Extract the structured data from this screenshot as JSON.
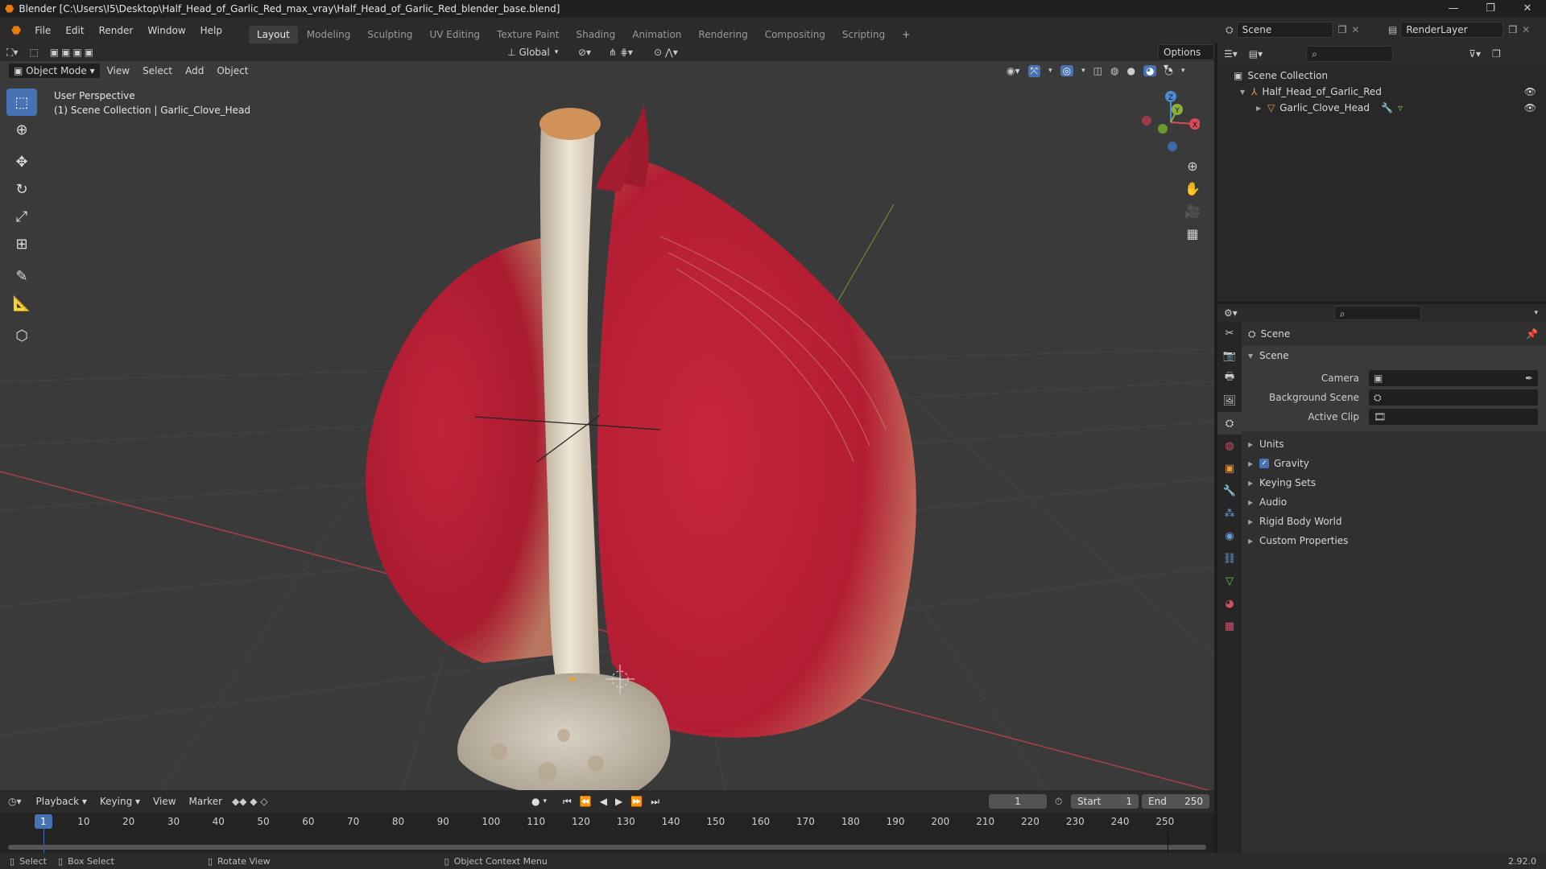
{
  "window": {
    "title": "Blender [C:\\Users\\I5\\Desktop\\Half_Head_of_Garlic_Red_max_vray\\Half_Head_of_Garlic_Red_blender_base.blend]"
  },
  "menu": [
    "File",
    "Edit",
    "Render",
    "Window",
    "Help"
  ],
  "workspaces": [
    "Layout",
    "Modeling",
    "Sculpting",
    "UV Editing",
    "Texture Paint",
    "Shading",
    "Animation",
    "Rendering",
    "Compositing",
    "Scripting"
  ],
  "top_right": {
    "scene": "Scene",
    "render_layer": "RenderLayer"
  },
  "viewport": {
    "transform_orientation": "Global",
    "options_label": "Options",
    "mode": "Object Mode",
    "header_menu": [
      "View",
      "Select",
      "Add",
      "Object"
    ],
    "overlay_line1": "User Perspective",
    "overlay_line2": "(1) Scene Collection | Garlic_Clove_Head",
    "gizmo": {
      "x": "X",
      "y": "Y",
      "z": "Z"
    }
  },
  "outliner": {
    "root": "Scene Collection",
    "items": [
      "Half_Head_of_Garlic_Red",
      "Garlic_Clove_Head"
    ]
  },
  "properties": {
    "header": "Scene",
    "panel": "Scene",
    "fields": [
      {
        "label": "Camera"
      },
      {
        "label": "Background Scene"
      },
      {
        "label": "Active Clip"
      }
    ],
    "subpanels": [
      "Units",
      "Gravity",
      "Keying Sets",
      "Audio",
      "Rigid Body World",
      "Custom Properties"
    ],
    "gravity_checked": true
  },
  "timeline": {
    "menu": [
      "Playback",
      "Keying",
      "View",
      "Marker"
    ],
    "current_frame": "1",
    "start_label": "Start",
    "start": "1",
    "end_label": "End",
    "end": "250",
    "ticks": [
      "1",
      "10",
      "20",
      "30",
      "40",
      "50",
      "60",
      "70",
      "80",
      "90",
      "100",
      "110",
      "120",
      "130",
      "140",
      "150",
      "160",
      "170",
      "180",
      "190",
      "200",
      "210",
      "220",
      "230",
      "240",
      "250"
    ]
  },
  "statusbar": {
    "items": [
      "Select",
      "Box Select",
      "Rotate View",
      "Object Context Menu"
    ],
    "version": "2.92.0"
  },
  "colors": {
    "accent": "#4772b3",
    "garlic_red": "#c0243a",
    "stem": "#e6dccb",
    "axis_x": "#d94a58",
    "axis_y": "#8cb03c",
    "axis_z": "#4a8cd9"
  }
}
